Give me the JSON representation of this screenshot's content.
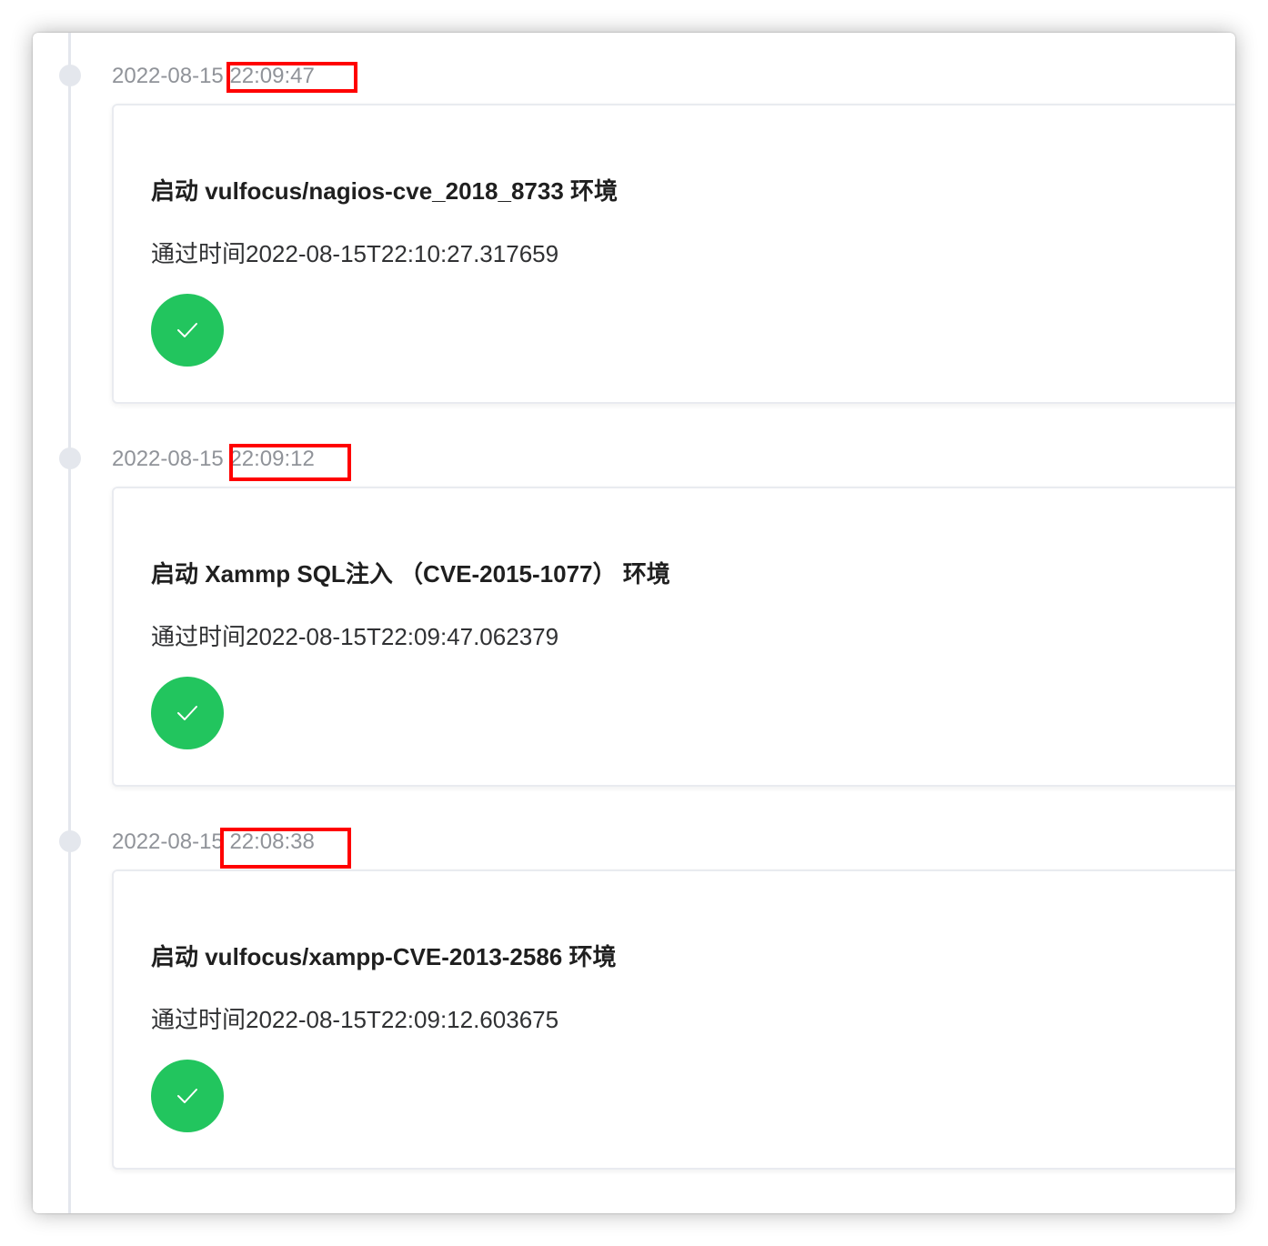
{
  "timeline": [
    {
      "date": "2022-08-15",
      "time": "22:09:47",
      "title": "启动 vulfocus/nagios-cve_2018_8733 环境",
      "pass_time": "通过时间2022-08-15T22:10:27.317659",
      "status_icon": "check-icon",
      "status_color": "#22c55e"
    },
    {
      "date": "2022-08-15",
      "time": "22:09:12",
      "title": "启动 Xammp SQL注入 （CVE-2015-1077） 环境",
      "pass_time": "通过时间2022-08-15T22:09:47.062379",
      "status_icon": "check-icon",
      "status_color": "#22c55e"
    },
    {
      "date": "2022-08-15",
      "time": "22:08:38",
      "title": "启动 vulfocus/xampp-CVE-2013-2586 环境",
      "pass_time": "通过时间2022-08-15T22:09:12.603675",
      "status_icon": "check-icon",
      "status_color": "#22c55e"
    }
  ],
  "colors": {
    "timeline_line": "#e4e7ed",
    "highlight": "#ff0000",
    "timestamp_text": "#909399"
  }
}
